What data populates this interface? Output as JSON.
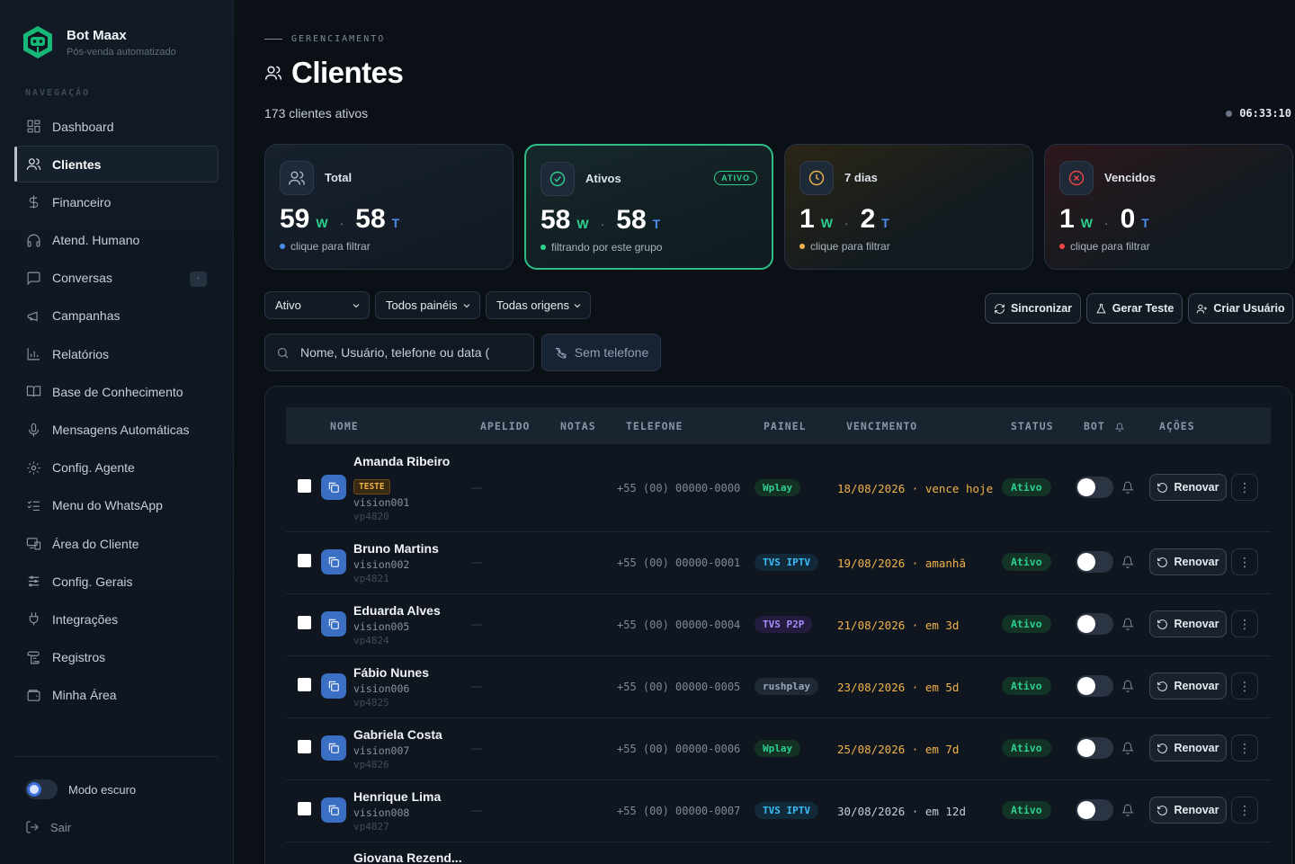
{
  "brand": {
    "name": "Bot Maax",
    "subtitle": "Pós-venda automatizado"
  },
  "sidebar": {
    "section": "NAVEGAÇÃO",
    "items": [
      {
        "label": "Dashboard",
        "icon": "dashboard-icon",
        "active": false
      },
      {
        "label": "Clientes",
        "icon": "users-icon",
        "active": true
      },
      {
        "label": "Financeiro",
        "icon": "dollar-icon",
        "active": false
      },
      {
        "label": "Atend. Humano",
        "icon": "headphones-icon",
        "active": false
      },
      {
        "label": "Conversas",
        "icon": "chat-icon",
        "active": false,
        "badge": "·"
      },
      {
        "label": "Campanhas",
        "icon": "megaphone-icon",
        "active": false
      },
      {
        "label": "Relatórios",
        "icon": "bar-chart-icon",
        "active": false
      },
      {
        "label": "Base de Conhecimento",
        "icon": "book-icon",
        "active": false
      },
      {
        "label": "Mensagens Automáticas",
        "icon": "microphone-icon",
        "active": false
      },
      {
        "label": "Config. Agente",
        "icon": "gear-icon",
        "active": false
      },
      {
        "label": "Menu do WhatsApp",
        "icon": "list-check-icon",
        "active": false
      },
      {
        "label": "Área do Cliente",
        "icon": "devices-icon",
        "active": false
      },
      {
        "label": "Config. Gerais",
        "icon": "sliders-icon",
        "active": false
      },
      {
        "label": "Integrações",
        "icon": "plug-icon",
        "active": false
      },
      {
        "label": "Registros",
        "icon": "scroll-icon",
        "active": false
      },
      {
        "label": "Minha Área",
        "icon": "wallet-icon",
        "active": false
      }
    ],
    "dark_mode_label": "Modo escuro",
    "logout_label": "Sair"
  },
  "header": {
    "eyebrow": "GERENCIAMENTO",
    "title": "Clientes",
    "subtitle": "173 clientes ativos",
    "clock": "06:33:10"
  },
  "stats": [
    {
      "label": "Total",
      "w": "59",
      "t": "58",
      "hint": "clique para filtrar",
      "hint_color": "#4c8ff0",
      "variant": "default"
    },
    {
      "label": "Ativos",
      "badge": "ATIVO",
      "w": "58",
      "t": "58",
      "hint": "filtrando por este grupo",
      "hint_color": "#2dd08f",
      "variant": "active"
    },
    {
      "label": "7 dias",
      "w": "1",
      "t": "2",
      "hint": "clique para filtrar",
      "hint_color": "#f0b24a",
      "variant": "warn"
    },
    {
      "label": "Vencidos",
      "w": "1",
      "t": "0",
      "hint": "clique para filtrar",
      "hint_color": "#ef4444",
      "variant": "danger"
    }
  ],
  "stat_suffix": {
    "w": "W",
    "t": "T",
    "sep": "·"
  },
  "filters": {
    "status": "Ativo",
    "panels": "Todos painéis",
    "origins": "Todas origens",
    "search_placeholder": "Nome, Usuário, telefone ou data (",
    "no_phone": "Sem telefone"
  },
  "actions": {
    "sync": "Sincronizar",
    "test": "Gerar Teste",
    "create": "Criar Usuário"
  },
  "table": {
    "headers": {
      "name": "NOME",
      "nick": "APELIDO",
      "notes": "NOTAS",
      "phone": "TELEFONE",
      "panel": "PAINEL",
      "due": "VENCIMENTO",
      "status": "STATUS",
      "bot": "BOT",
      "actions": "AÇÕES"
    },
    "renew_label": "Renovar",
    "rows": [
      {
        "name": "Amanda Ribeiro",
        "tag": "TESTE",
        "user": "vision001",
        "pass": "vp4820",
        "nick": "—",
        "phone": "+55 (00) 00000-0000",
        "panel": "Wplay",
        "panel_fg": "#2dd08f",
        "panel_bg": "#143223",
        "due": "18/08/2026 · vence hoje",
        "due_color": "#f0b24a",
        "status": "Ativo"
      },
      {
        "name": "Bruno Martins",
        "user": "vision002",
        "pass": "vp4821",
        "nick": "—",
        "phone": "+55 (00) 00000-0001",
        "panel": "TVS IPTV",
        "panel_fg": "#38bdf8",
        "panel_bg": "#12293a",
        "due": "19/08/2026 · amanhã",
        "due_color": "#f0b24a",
        "status": "Ativo"
      },
      {
        "name": "Eduarda Alves",
        "user": "vision005",
        "pass": "vp4824",
        "nick": "—",
        "phone": "+55 (00) 00000-0004",
        "panel": "TVS P2P",
        "panel_fg": "#a78bfa",
        "panel_bg": "#241c3e",
        "due": "21/08/2026 · em 3d",
        "due_color": "#f0b24a",
        "status": "Ativo"
      },
      {
        "name": "Fábio Nunes",
        "user": "vision006",
        "pass": "vp4825",
        "nick": "—",
        "phone": "+55 (00) 00000-0005",
        "panel": "rushplay",
        "panel_fg": "#9aa6b6",
        "panel_bg": "#202a36",
        "due": "23/08/2026 · em 5d",
        "due_color": "#f0b24a",
        "status": "Ativo"
      },
      {
        "name": "Gabriela Costa",
        "user": "vision007",
        "pass": "vp4826",
        "nick": "—",
        "phone": "+55 (00) 00000-0006",
        "panel": "Wplay",
        "panel_fg": "#2dd08f",
        "panel_bg": "#143223",
        "due": "25/08/2026 · em 7d",
        "due_color": "#f0b24a",
        "status": "Ativo"
      },
      {
        "name": "Henrique Lima",
        "user": "vision008",
        "pass": "vp4827",
        "nick": "—",
        "phone": "+55 (00) 00000-0007",
        "panel": "TVS IPTV",
        "panel_fg": "#38bdf8",
        "panel_bg": "#12293a",
        "due": "30/08/2026 · em 12d",
        "due_color": "#c6ced8",
        "status": "Ativo"
      },
      {
        "name": "Giovana Rezend...",
        "user": "",
        "pass": "",
        "nick": "",
        "phone": "",
        "panel": "",
        "due": "",
        "status": ""
      }
    ]
  }
}
